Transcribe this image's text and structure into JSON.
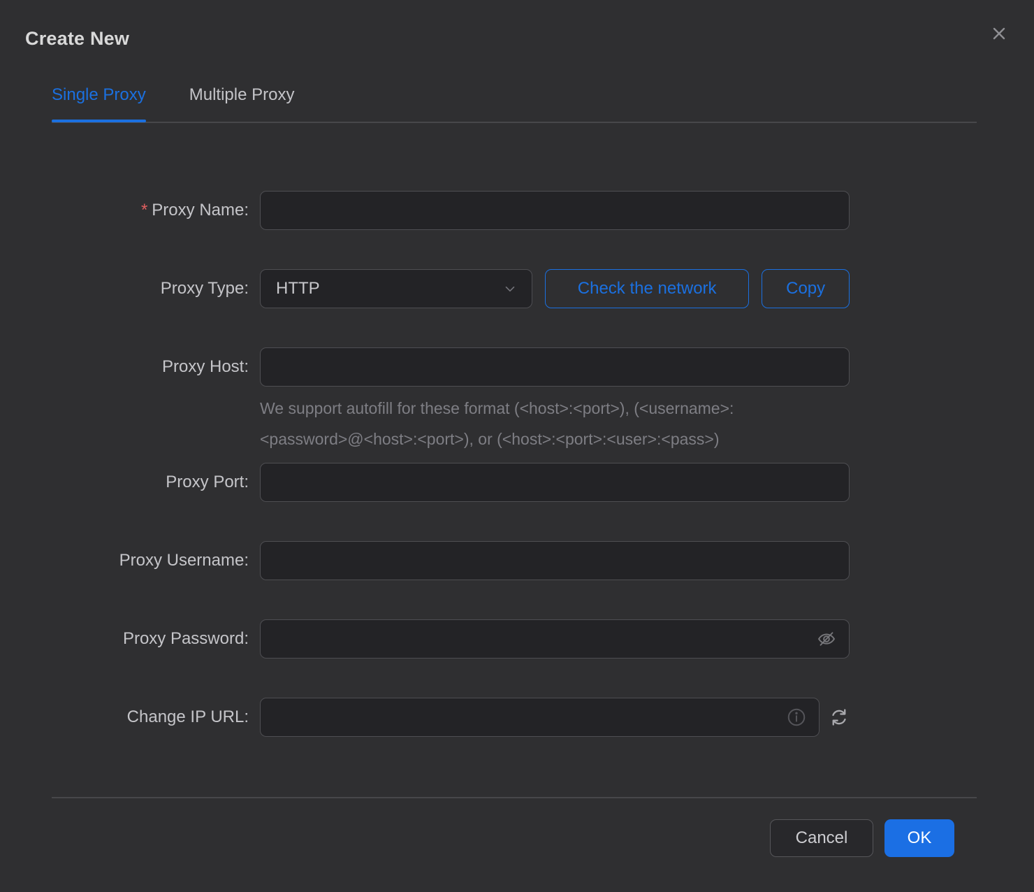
{
  "modal": {
    "title": "Create New"
  },
  "tabs": [
    {
      "label": "Single Proxy",
      "active": true
    },
    {
      "label": "Multiple Proxy",
      "active": false
    }
  ],
  "form": {
    "required_marker": "*",
    "proxy_name": {
      "label": "Proxy Name:",
      "value": "",
      "placeholder": ""
    },
    "proxy_type": {
      "label": "Proxy Type:",
      "value": "HTTP"
    },
    "check_network_label": "Check the network",
    "copy_label": "Copy",
    "proxy_host": {
      "label": "Proxy Host:",
      "value": "",
      "placeholder": "",
      "helper_line1": "We support autofill for these format (<host>:<port>), (<username>:",
      "helper_line2": "<password>@<host>:<port>), or (<host>:<port>:<user>:<pass>)"
    },
    "proxy_port": {
      "label": "Proxy Port:",
      "value": "",
      "placeholder": ""
    },
    "proxy_username": {
      "label": "Proxy Username:",
      "value": "",
      "placeholder": ""
    },
    "proxy_password": {
      "label": "Proxy Password:",
      "value": "",
      "placeholder": ""
    },
    "change_ip_url": {
      "label": "Change IP URL:",
      "value": "",
      "placeholder": ""
    }
  },
  "icons": {
    "close": "close-icon",
    "chevron_down": "chevron-down-icon",
    "eye_invisible": "eye-invisible-icon",
    "info": "info-icon",
    "refresh": "refresh-icon"
  },
  "footer": {
    "cancel_label": "Cancel",
    "ok_label": "OK"
  },
  "colors": {
    "accent_blue": "#1b70e0",
    "ok_button_blue": "#1b6fe4",
    "required_red": "#e05f5f",
    "modal_bg": "#2f2f31",
    "input_bg": "#232326",
    "input_border": "#4e4e52",
    "divider": "#47474a",
    "helper_text": "#7e7e84",
    "title_text": "#d9d9d9",
    "label_text": "#c5c5c9"
  }
}
